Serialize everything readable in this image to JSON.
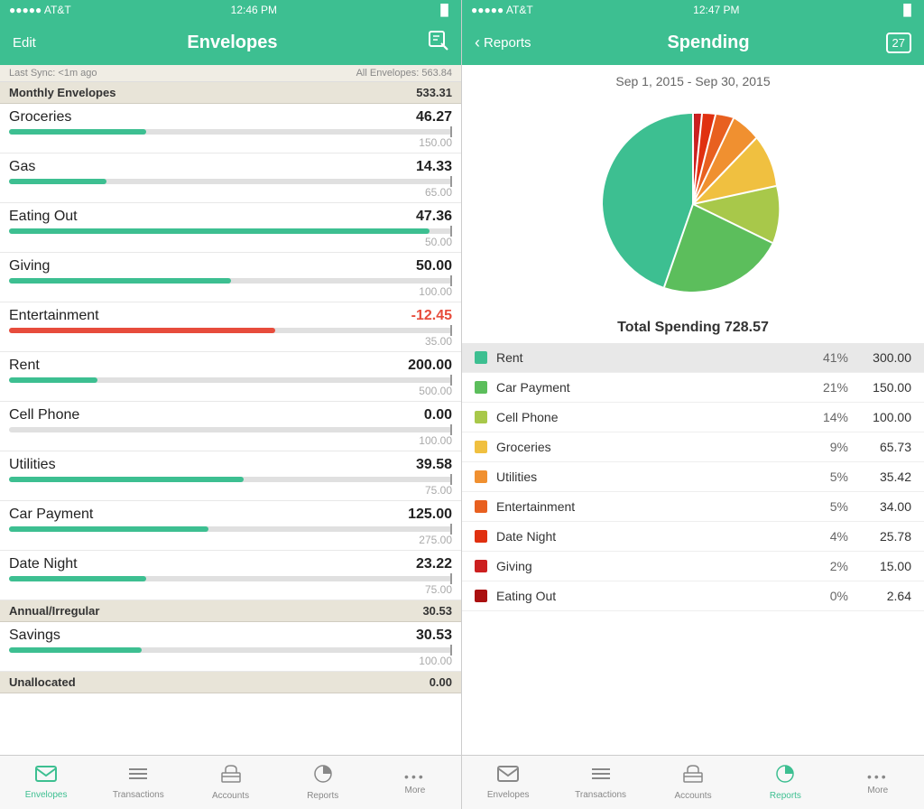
{
  "left": {
    "status": {
      "carrier": "●●●●● AT&T",
      "wifi": "WiFi",
      "time": "12:46 PM",
      "battery": "Battery"
    },
    "header": {
      "edit": "Edit",
      "title": "Envelopes",
      "compose": "✏"
    },
    "sync": {
      "last_sync": "Last Sync: <1m ago",
      "all_envelopes": "All Envelopes: 563.84"
    },
    "sections": [
      {
        "id": "monthly",
        "label": "Monthly Envelopes",
        "amount": "533.31",
        "items": [
          {
            "name": "Groceries",
            "amount": "46.27",
            "budget": "150.00",
            "pct": 31,
            "color": "green"
          },
          {
            "name": "Gas",
            "amount": "14.33",
            "budget": "65.00",
            "pct": 22,
            "color": "green"
          },
          {
            "name": "Eating Out",
            "amount": "47.36",
            "budget": "50.00",
            "pct": 95,
            "color": "green"
          },
          {
            "name": "Giving",
            "amount": "50.00",
            "budget": "100.00",
            "pct": 50,
            "color": "green"
          },
          {
            "name": "Entertainment",
            "amount": "-12.45",
            "budget": "35.00",
            "pct": 60,
            "color": "red"
          },
          {
            "name": "Rent",
            "amount": "200.00",
            "budget": "500.00",
            "pct": 20,
            "color": "green"
          },
          {
            "name": "Cell Phone",
            "amount": "0.00",
            "budget": "100.00",
            "pct": 0,
            "color": "green"
          },
          {
            "name": "Utilities",
            "amount": "39.58",
            "budget": "75.00",
            "pct": 53,
            "color": "green"
          },
          {
            "name": "Car Payment",
            "amount": "125.00",
            "budget": "275.00",
            "pct": 45,
            "color": "green"
          },
          {
            "name": "Date Night",
            "amount": "23.22",
            "budget": "75.00",
            "pct": 31,
            "color": "green"
          }
        ]
      },
      {
        "id": "annual",
        "label": "Annual/Irregular",
        "amount": "30.53",
        "items": [
          {
            "name": "Savings",
            "amount": "30.53",
            "budget": "100.00",
            "pct": 30,
            "color": "green"
          }
        ]
      },
      {
        "id": "unallocated",
        "label": "Unallocated",
        "amount": "0.00",
        "items": []
      }
    ],
    "nav": [
      {
        "id": "envelopes",
        "label": "Envelopes",
        "active": true
      },
      {
        "id": "transactions",
        "label": "Transactions",
        "active": false
      },
      {
        "id": "accounts",
        "label": "Accounts",
        "active": false
      },
      {
        "id": "reports",
        "label": "Reports",
        "active": false
      },
      {
        "id": "more",
        "label": "More",
        "active": false
      }
    ]
  },
  "right": {
    "status": {
      "carrier": "●●●●● AT&T",
      "wifi": "WiFi",
      "time": "12:47 PM",
      "battery": "Battery"
    },
    "header": {
      "back": "Reports",
      "title": "Spending",
      "cal": "27"
    },
    "chart": {
      "date_range": "Sep 1, 2015 - Sep 30, 2015",
      "total_label": "Total Spending 728.57"
    },
    "legend": [
      {
        "name": "Rent",
        "pct": "41%",
        "amount": "300.00",
        "color": "#3dbf91",
        "highlighted": true
      },
      {
        "name": "Car Payment",
        "pct": "21%",
        "amount": "150.00",
        "color": "#5cbe5c",
        "highlighted": false
      },
      {
        "name": "Cell Phone",
        "pct": "14%",
        "amount": "100.00",
        "color": "#a8c84a",
        "highlighted": false
      },
      {
        "name": "Groceries",
        "pct": "9%",
        "amount": "65.73",
        "color": "#f0c040",
        "highlighted": false
      },
      {
        "name": "Utilities",
        "pct": "5%",
        "amount": "35.42",
        "color": "#f09030",
        "highlighted": false
      },
      {
        "name": "Entertainment",
        "pct": "5%",
        "amount": "34.00",
        "color": "#e86020",
        "highlighted": false
      },
      {
        "name": "Date Night",
        "pct": "4%",
        "amount": "25.78",
        "color": "#e03010",
        "highlighted": false
      },
      {
        "name": "Giving",
        "pct": "2%",
        "amount": "15.00",
        "color": "#cc2020",
        "highlighted": false
      },
      {
        "name": "Eating Out",
        "pct": "0%",
        "amount": "2.64",
        "color": "#aa1010",
        "highlighted": false
      }
    ],
    "nav": [
      {
        "id": "envelopes",
        "label": "Envelopes",
        "active": false
      },
      {
        "id": "transactions",
        "label": "Transactions",
        "active": false
      },
      {
        "id": "accounts",
        "label": "Accounts",
        "active": false
      },
      {
        "id": "reports",
        "label": "Reports",
        "active": true
      },
      {
        "id": "more",
        "label": "More",
        "active": false
      }
    ]
  }
}
